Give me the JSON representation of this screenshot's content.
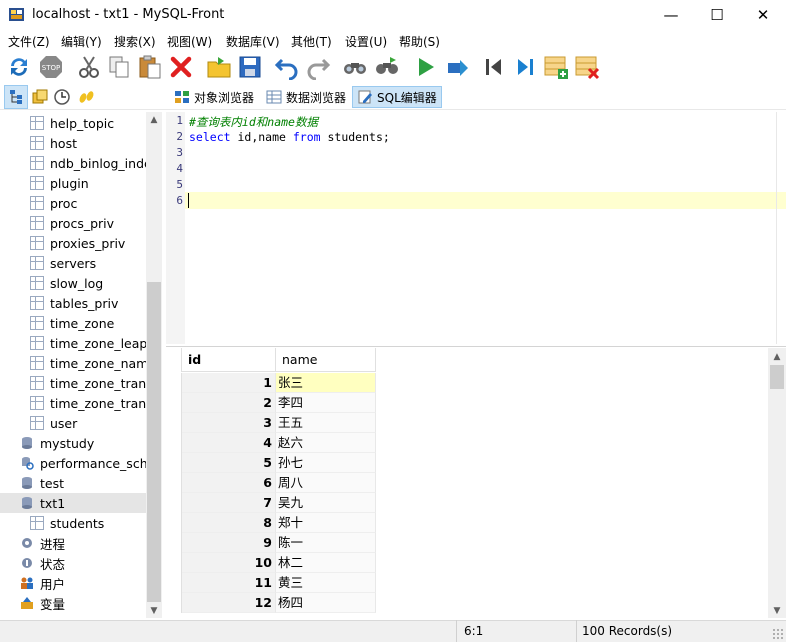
{
  "window": {
    "title": "localhost - txt1 - MySQL-Front",
    "minimize": "—",
    "maximize": "☐",
    "close": "✕"
  },
  "menu": [
    "文件(Z)",
    "编辑(Y)",
    "搜索(X)",
    "视图(W)",
    "数据库(V)",
    "其他(T)",
    "设置(U)",
    "帮助(S)"
  ],
  "tabs": {
    "object_browser": "对象浏览器",
    "data_browser": "数据浏览器",
    "sql_editor": "SQL编辑器"
  },
  "sidebar": {
    "tables": [
      "help_topic",
      "host",
      "ndb_binlog_inde",
      "plugin",
      "proc",
      "procs_priv",
      "proxies_priv",
      "servers",
      "slow_log",
      "tables_priv",
      "time_zone",
      "time_zone_leap_s",
      "time_zone_name",
      "time_zone_transi",
      "time_zone_transi",
      "user"
    ],
    "databases": [
      "mystudy",
      "performance_sche",
      "test",
      "txt1"
    ],
    "txt1_tables": [
      "students"
    ],
    "system": [
      "进程",
      "状态",
      "用户",
      "变量"
    ]
  },
  "editor": {
    "line_numbers": [
      "1",
      "2",
      "3",
      "4",
      "5",
      "6"
    ],
    "line1_comment": "#查询表内id和name数据",
    "line2_kw1": "select",
    "line2_mid": " id,name ",
    "line2_kw2": "from",
    "line2_end": " students;"
  },
  "grid": {
    "columns": [
      "id",
      "name"
    ],
    "rows": [
      [
        "1",
        "张三"
      ],
      [
        "2",
        "李四"
      ],
      [
        "3",
        "王五"
      ],
      [
        "4",
        "赵六"
      ],
      [
        "5",
        "孙七"
      ],
      [
        "6",
        "周八"
      ],
      [
        "7",
        "吴九"
      ],
      [
        "8",
        "郑十"
      ],
      [
        "9",
        "陈一"
      ],
      [
        "10",
        "林二"
      ],
      [
        "11",
        "黄三"
      ],
      [
        "12",
        "杨四"
      ]
    ]
  },
  "status": {
    "position": "6:1",
    "records": "100 Records(s)"
  },
  "colors": {
    "selected_row": "#e5e5e5",
    "current_line": "#ffffd0",
    "active_cell": "#ffffc0",
    "comment": "#008000",
    "keyword": "#0000ff"
  }
}
